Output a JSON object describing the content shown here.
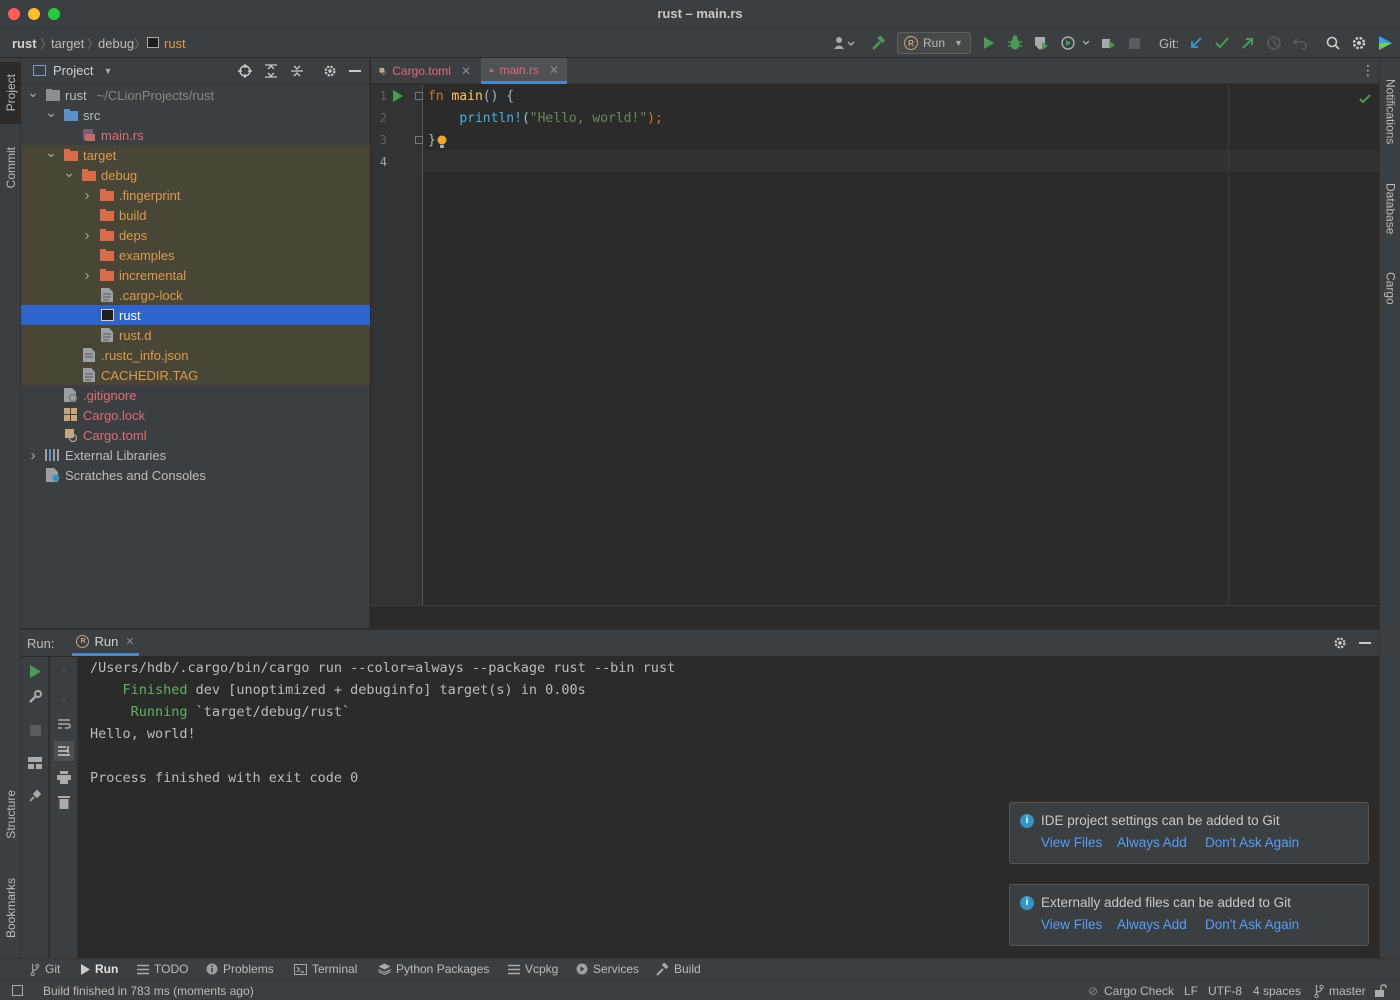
{
  "window": {
    "title": "rust – main.rs"
  },
  "breadcrumb": [
    "rust",
    "target",
    "debug",
    "rust"
  ],
  "toolbar": {
    "run_config": "Run",
    "git_label": "Git:"
  },
  "side_tabs": {
    "left_top": [
      "Project",
      "Commit"
    ],
    "left_bottom": [
      "Structure",
      "Bookmarks"
    ],
    "right": [
      "Notifications",
      "Database",
      "Cargo"
    ]
  },
  "project": {
    "header": "Project",
    "tree": [
      {
        "label": "rust",
        "suffix": "~/CLionProjects/rust",
        "depth": 0,
        "arrow": "down",
        "kind": "module",
        "color": "#bbbbbb"
      },
      {
        "label": "src",
        "depth": 1,
        "arrow": "down",
        "kind": "folder-blue",
        "color": "#bbbbbb"
      },
      {
        "label": "main.rs",
        "depth": 2,
        "arrow": "",
        "kind": "rs-file",
        "color": "#e06c75"
      },
      {
        "label": "target",
        "depth": 1,
        "arrow": "down",
        "kind": "folder-orange",
        "color": "#d99c4b",
        "excluded": true
      },
      {
        "label": "debug",
        "depth": 2,
        "arrow": "down",
        "kind": "folder-orange",
        "color": "#d99c4b",
        "excluded": true
      },
      {
        "label": ".fingerprint",
        "depth": 3,
        "arrow": "right",
        "kind": "folder-orange",
        "color": "#d99c4b",
        "excluded": true
      },
      {
        "label": "build",
        "depth": 3,
        "arrow": "",
        "kind": "folder-orange",
        "color": "#d99c4b",
        "excluded": true
      },
      {
        "label": "deps",
        "depth": 3,
        "arrow": "right",
        "kind": "folder-orange",
        "color": "#d99c4b",
        "excluded": true
      },
      {
        "label": "examples",
        "depth": 3,
        "arrow": "",
        "kind": "folder-orange",
        "color": "#d99c4b",
        "excluded": true
      },
      {
        "label": "incremental",
        "depth": 3,
        "arrow": "right",
        "kind": "folder-orange",
        "color": "#d99c4b",
        "excluded": true
      },
      {
        "label": ".cargo-lock",
        "depth": 3,
        "arrow": "",
        "kind": "text-file",
        "color": "#d99c4b",
        "excluded": true
      },
      {
        "label": "rust",
        "depth": 3,
        "arrow": "",
        "kind": "exec-file",
        "color": "#ffffff",
        "selected": true
      },
      {
        "label": "rust.d",
        "depth": 3,
        "arrow": "",
        "kind": "text-file",
        "color": "#d99c4b",
        "excluded": true
      },
      {
        "label": ".rustc_info.json",
        "depth": 2,
        "arrow": "",
        "kind": "json-file",
        "color": "#d99c4b",
        "excluded": true
      },
      {
        "label": "CACHEDIR.TAG",
        "depth": 2,
        "arrow": "",
        "kind": "text-file",
        "color": "#d99c4b",
        "excluded": true
      },
      {
        "label": ".gitignore",
        "depth": 1,
        "arrow": "",
        "kind": "ignore-file",
        "color": "#e06c75"
      },
      {
        "label": "Cargo.lock",
        "depth": 1,
        "arrow": "",
        "kind": "cargo-file",
        "color": "#e06c75"
      },
      {
        "label": "Cargo.toml",
        "depth": 1,
        "arrow": "",
        "kind": "toml-file",
        "color": "#e06c75"
      },
      {
        "label": "External Libraries",
        "depth": 0,
        "arrow": "right",
        "kind": "libs",
        "color": "#bbbbbb"
      },
      {
        "label": "Scratches and Consoles",
        "depth": 0,
        "arrow": "",
        "kind": "scratch",
        "color": "#bbbbbb"
      }
    ]
  },
  "editor": {
    "tabs": [
      {
        "label": "Cargo.toml",
        "active": false
      },
      {
        "label": "main.rs",
        "active": true
      }
    ],
    "line_numbers": [
      "1",
      "2",
      "3",
      "4"
    ],
    "code": {
      "l1_kw": "fn",
      "l1_name": "main",
      "l1_rest": "() {",
      "l2_macro": "println!",
      "l2_paren": "(",
      "l2_str": "\"Hello, world!\"",
      "l2_end": ");",
      "l3": "}"
    }
  },
  "run_panel": {
    "label": "Run:",
    "tab": "Run",
    "console": [
      {
        "text": "/Users/hdb/.cargo/bin/cargo run --color=always --package rust --bin rust",
        "kind": "plain"
      },
      {
        "prefix": "    Finished",
        "text": " dev [unoptimized + debuginfo] target(s) in 0.00s",
        "kind": "status"
      },
      {
        "prefix": "     Running",
        "text": " `target/debug/rust`",
        "kind": "status"
      },
      {
        "text": "Hello, world!",
        "kind": "plain"
      },
      {
        "text": "",
        "kind": "plain"
      },
      {
        "text": "Process finished with exit code 0",
        "kind": "plain"
      }
    ]
  },
  "notifications": [
    {
      "message": "IDE project settings can be added to Git",
      "actions": [
        "View Files",
        "Always Add",
        "Don't Ask Again"
      ]
    },
    {
      "message": "Externally added files can be added to Git",
      "actions": [
        "View Files",
        "Always Add",
        "Don't Ask Again"
      ]
    }
  ],
  "tool_windows": [
    {
      "label": "Git",
      "icon": "git-branch-icon"
    },
    {
      "label": "Run",
      "icon": "play-icon",
      "active": true
    },
    {
      "label": "TODO",
      "icon": "list-icon"
    },
    {
      "label": "Problems",
      "icon": "info-icon"
    },
    {
      "label": "Terminal",
      "icon": "terminal-icon"
    },
    {
      "label": "Python Packages",
      "icon": "layers-icon"
    },
    {
      "label": "Vcpkg",
      "icon": "list-icon"
    },
    {
      "label": "Services",
      "icon": "services-icon"
    },
    {
      "label": "Build",
      "icon": "hammer-icon"
    }
  ],
  "status_bar": {
    "message": "Build finished in 783 ms (moments ago)",
    "cargo_check": "Cargo Check",
    "line_sep": "LF",
    "encoding": "UTF-8",
    "indent": "4 spaces",
    "branch": "master"
  },
  "colors": {
    "keyword": "#cc7832",
    "fn_name": "#ffc66d",
    "macro": "#4eade5",
    "string": "#6a8759",
    "green": "#499c54",
    "link": "#589df6",
    "selection": "#2f65ca"
  }
}
